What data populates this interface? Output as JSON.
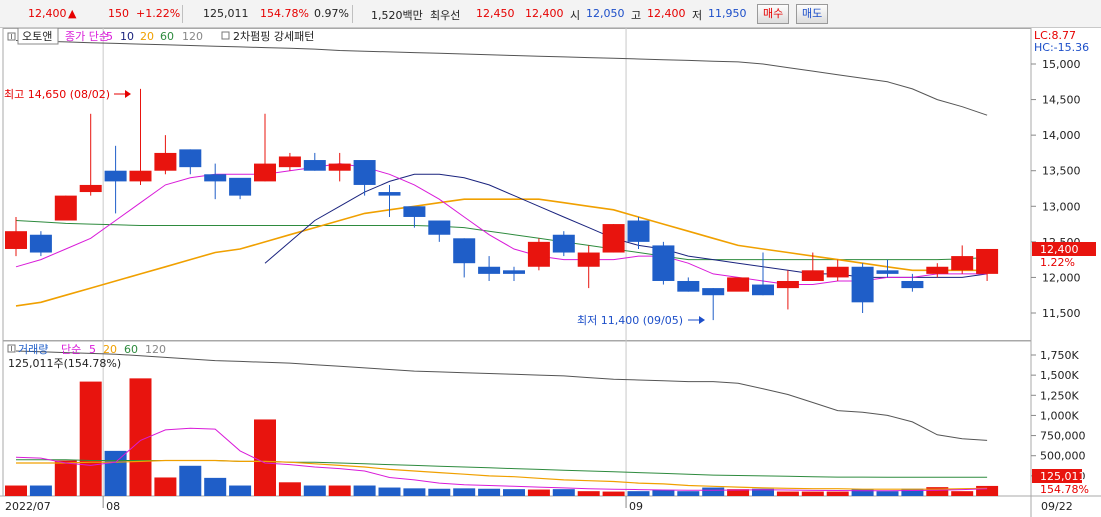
{
  "quote": {
    "price": "12,400",
    "up_arrow": "▲",
    "change": "150",
    "change_pct": "+1.22%",
    "volume": "125,011",
    "volume_ratio": "154.78%",
    "turnover_ratio": "0.97%",
    "amount": "1,520백만",
    "best_label": "최우선",
    "best_ask": "12,450",
    "best_bid": "12,400",
    "open_label": "시",
    "open": "12,050",
    "high_label": "고",
    "high": "12,400",
    "low_label": "저",
    "low": "11,950"
  },
  "buttons": {
    "buy": "매수",
    "sell": "매도"
  },
  "price_panel": {
    "auto_label": "오토앤",
    "ma_prefix": "종가 단순",
    "ma_periods": [
      "5",
      "10",
      "20",
      "60",
      "120"
    ],
    "pattern_label": "2차펌핑 강세패턴",
    "lc_label": "LC:8.77",
    "hc_label": "HC:-15.36",
    "current_price_tag": "12,400",
    "current_pct_tag": "1.22%",
    "high_annotation": "최고 14,650 (08/02)",
    "low_annotation": "최저 11,400 (09/05)"
  },
  "volume_panel": {
    "title": "거래량",
    "ma_prefix": "단순",
    "ma_periods": [
      "5",
      "20",
      "60",
      "120"
    ],
    "info": "125,011주(154.78%)",
    "current_tag": "125,011",
    "current_pct_tag": "154.78%"
  },
  "colors": {
    "up": "#e8140e",
    "down": "#1f5ec8",
    "ma5": "#d91bd9",
    "ma10": "#1a237e",
    "ma20": "#f0a000",
    "ma60": "#2e8b3e",
    "ma120": "#555555"
  },
  "chart_data": [
    {
      "type": "candlestick",
      "x": [
        "07/26",
        "07/27",
        "07/28",
        "07/29",
        "08/01",
        "08/02",
        "08/03",
        "08/04",
        "08/05",
        "08/08",
        "08/09",
        "08/10",
        "08/11",
        "08/12",
        "08/16",
        "08/17",
        "08/18",
        "08/19",
        "08/22",
        "08/23",
        "08/24",
        "08/25",
        "08/26",
        "08/29",
        "08/30",
        "08/31",
        "09/01",
        "09/02",
        "09/05",
        "09/06",
        "09/07",
        "09/08",
        "09/13",
        "09/14",
        "09/15",
        "09/16",
        "09/19",
        "09/20",
        "09/21",
        "09/22"
      ],
      "open": [
        12400,
        12600,
        12800,
        13200,
        13500,
        13350,
        13500,
        13800,
        13450,
        13400,
        13350,
        13550,
        13650,
        13500,
        13650,
        13200,
        13000,
        12800,
        12550,
        12150,
        12100,
        12150,
        12600,
        12150,
        12350,
        12800,
        12450,
        11950,
        11850,
        11800,
        11900,
        11850,
        11950,
        12000,
        12150,
        12100,
        11950,
        12050,
        12100,
        12050
      ],
      "close": [
        12650,
        12350,
        13150,
        13300,
        13350,
        13500,
        13750,
        13550,
        13350,
        13150,
        13600,
        13700,
        13500,
        13600,
        13300,
        13150,
        12850,
        12600,
        12200,
        12050,
        12050,
        12500,
        12350,
        12350,
        12750,
        12500,
        11950,
        11800,
        11750,
        12000,
        11750,
        11950,
        12100,
        12150,
        11650,
        12050,
        11850,
        12150,
        12300,
        12400
      ],
      "high": [
        12850,
        12650,
        13150,
        14300,
        13850,
        14650,
        14000,
        13800,
        13600,
        13200,
        14300,
        13750,
        13750,
        13750,
        13400,
        13300,
        12950,
        12800,
        12550,
        12300,
        12150,
        12550,
        12650,
        12450,
        12750,
        12850,
        12500,
        12000,
        11850,
        12000,
        12350,
        12100,
        12350,
        12250,
        12200,
        12250,
        12050,
        12200,
        12450,
        12400
      ],
      "low": [
        12300,
        12300,
        12800,
        13150,
        12900,
        13300,
        13450,
        13450,
        13100,
        13100,
        13350,
        13500,
        13500,
        13350,
        13150,
        12850,
        12700,
        12500,
        12000,
        11950,
        11950,
        12100,
        12300,
        11850,
        12350,
        12400,
        11900,
        11800,
        11400,
        11850,
        11750,
        11550,
        11950,
        11950,
        11500,
        12000,
        11800,
        12000,
        12050,
        11950
      ],
      "ylim": [
        11200,
        15450
      ],
      "yticks": [
        "11,500",
        "12,000",
        "12,500",
        "13,000",
        "13,500",
        "14,000",
        "14,500",
        "15,000"
      ],
      "xlabels": [
        "2022/07",
        "08",
        "09",
        "09/22"
      ],
      "ma5": [
        12150,
        12250,
        12400,
        12550,
        12800,
        13050,
        13300,
        13400,
        13450,
        13450,
        13450,
        13500,
        13550,
        13600,
        13550,
        13450,
        13300,
        13100,
        12850,
        12600,
        12400,
        12300,
        12250,
        12250,
        12250,
        12300,
        12300,
        12200,
        12050,
        12000,
        11950,
        11900,
        11900,
        11950,
        11950,
        12000,
        12000,
        12050,
        12050,
        12050
      ],
      "ma10": [
        null,
        null,
        null,
        null,
        null,
        null,
        null,
        null,
        null,
        null,
        12200,
        12500,
        12800,
        13000,
        13200,
        13350,
        13450,
        13450,
        13400,
        13300,
        13150,
        13000,
        12850,
        12700,
        12550,
        12450,
        12400,
        12300,
        12250,
        12200,
        12150,
        12100,
        12050,
        12050,
        12000,
        12000,
        12000,
        12000,
        12000,
        12050
      ],
      "ma20": [
        11600,
        11650,
        11750,
        11850,
        11950,
        12050,
        12150,
        12250,
        12350,
        12400,
        12500,
        12600,
        12700,
        12800,
        12900,
        12950,
        13000,
        13050,
        13100,
        13100,
        13100,
        13100,
        13050,
        13000,
        12950,
        12850,
        12750,
        12650,
        12550,
        12450,
        12400,
        12350,
        12300,
        12250,
        12200,
        12150,
        12100,
        12100,
        12100,
        12100
      ],
      "ma60": [
        12800,
        12780,
        12760,
        12750,
        12740,
        12730,
        12730,
        12730,
        12730,
        12730,
        12730,
        12730,
        12730,
        12730,
        12730,
        12730,
        12730,
        12720,
        12700,
        12650,
        12600,
        12550,
        12500,
        12450,
        12400,
        12350,
        12300,
        12250,
        12250,
        12250,
        12250,
        12250,
        12250,
        12250,
        12250,
        12250,
        12250,
        12250,
        12260,
        12280
      ],
      "ma120": [
        15330,
        15320,
        15310,
        15300,
        15290,
        15280,
        15270,
        15260,
        15250,
        15240,
        15230,
        15220,
        15210,
        15190,
        15180,
        15170,
        15160,
        15150,
        15140,
        15130,
        15120,
        15110,
        15100,
        15090,
        15080,
        15070,
        15060,
        15050,
        15040,
        15030,
        15000,
        14950,
        14900,
        14850,
        14800,
        14750,
        14650,
        14500,
        14400,
        14280
      ]
    },
    {
      "type": "bar",
      "x": [
        "07/26",
        "07/27",
        "07/28",
        "07/29",
        "08/01",
        "08/02",
        "08/03",
        "08/04",
        "08/05",
        "08/08",
        "08/09",
        "08/10",
        "08/11",
        "08/12",
        "08/16",
        "08/17",
        "08/18",
        "08/19",
        "08/22",
        "08/23",
        "08/24",
        "08/25",
        "08/26",
        "08/29",
        "08/30",
        "08/31",
        "09/01",
        "09/02",
        "09/05",
        "09/06",
        "09/07",
        "09/08",
        "09/13",
        "09/14",
        "09/15",
        "09/16",
        "09/19",
        "09/20",
        "09/21",
        "09/22"
      ],
      "values": [
        130000,
        130000,
        440000,
        1420000,
        560000,
        1460000,
        230000,
        375000,
        225000,
        130000,
        950000,
        170000,
        130000,
        130000,
        130000,
        105000,
        95000,
        90000,
        95000,
        90000,
        85000,
        80000,
        85000,
        60000,
        55000,
        60000,
        75000,
        60000,
        105000,
        85000,
        90000,
        55000,
        55000,
        55000,
        85000,
        60000,
        90000,
        110000,
        60000,
        125011
      ],
      "ylim": [
        0,
        1800000
      ],
      "yticks": [
        "250,000",
        "500,000",
        "750,000",
        "1,000K",
        "1,250K",
        "1,500K",
        "1,750K"
      ],
      "ma5": [
        480000,
        470000,
        410000,
        380000,
        420000,
        690000,
        820000,
        840000,
        830000,
        560000,
        410000,
        390000,
        360000,
        340000,
        310000,
        230000,
        200000,
        160000,
        140000,
        130000,
        120000,
        110000,
        100000,
        90000,
        85000,
        80000,
        75000,
        72000,
        72000,
        75000,
        78000,
        75000,
        70000,
        68000,
        65000,
        65000,
        68000,
        72000,
        80000,
        90000
      ],
      "ma20": [
        410000,
        410000,
        410000,
        420000,
        420000,
        430000,
        440000,
        440000,
        440000,
        430000,
        430000,
        420000,
        400000,
        380000,
        360000,
        330000,
        310000,
        290000,
        270000,
        250000,
        240000,
        220000,
        200000,
        190000,
        180000,
        160000,
        150000,
        130000,
        120000,
        110000,
        100000,
        95000,
        90000,
        90000,
        85000,
        85000,
        85000,
        85000,
        90000,
        95000
      ],
      "ma60": [
        450000,
        450000,
        450000,
        440000,
        440000,
        440000,
        440000,
        440000,
        440000,
        430000,
        430000,
        420000,
        420000,
        410000,
        400000,
        390000,
        380000,
        370000,
        360000,
        350000,
        340000,
        330000,
        320000,
        310000,
        300000,
        290000,
        280000,
        270000,
        260000,
        255000,
        250000,
        245000,
        240000,
        235000,
        235000,
        232000,
        232000,
        232000,
        232000,
        232000
      ],
      "ma120": [
        1800000,
        1790000,
        1780000,
        1770000,
        1760000,
        1740000,
        1720000,
        1700000,
        1680000,
        1670000,
        1660000,
        1650000,
        1630000,
        1610000,
        1590000,
        1570000,
        1550000,
        1540000,
        1530000,
        1520000,
        1510000,
        1500000,
        1490000,
        1470000,
        1450000,
        1440000,
        1430000,
        1420000,
        1420000,
        1400000,
        1330000,
        1260000,
        1160000,
        1060000,
        1040000,
        1000000,
        920000,
        760000,
        710000,
        690000
      ]
    }
  ]
}
